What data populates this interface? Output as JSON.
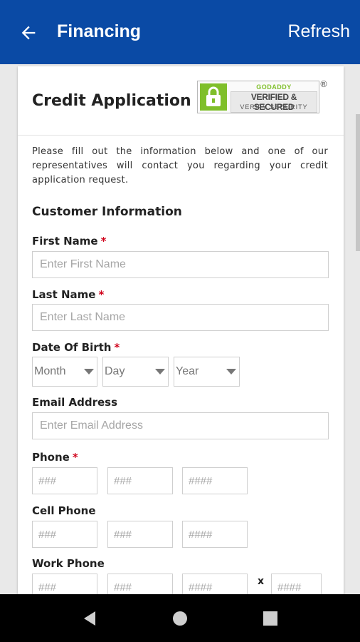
{
  "appbar": {
    "title": "Financing",
    "refresh_label": "Refresh",
    "back_icon": "arrow-left-icon",
    "color": "#0a4aa5"
  },
  "card": {
    "title": "Credit Application",
    "badge": {
      "brand": "GODADDY",
      "verified": "VERIFIED & SECURED",
      "verify": "VERIFY SECURITY",
      "reg_mark": "®"
    },
    "intro": "Please fill out the information below and one of our representatives will contact you regarding your credit application request."
  },
  "customer": {
    "section_title": "Customer Information",
    "required_mark": "*",
    "first_name": {
      "label": "First Name",
      "placeholder": "Enter First Name",
      "value": ""
    },
    "last_name": {
      "label": "Last Name",
      "placeholder": "Enter Last Name",
      "value": ""
    },
    "dob": {
      "label": "Date Of Birth",
      "month": "Month",
      "day": "Day",
      "year": "Year"
    },
    "email": {
      "label": "Email Address",
      "placeholder": "Enter Email Address",
      "value": ""
    },
    "phone": {
      "label": "Phone",
      "area": "###",
      "prefix": "###",
      "line": "####"
    },
    "cell_phone": {
      "label": "Cell Phone",
      "area": "###",
      "prefix": "###",
      "line": "####"
    },
    "work_phone": {
      "label": "Work Phone",
      "area": "###",
      "prefix": "###",
      "line": "####",
      "ext_label": "x",
      "ext": "####"
    }
  },
  "navbar": {
    "back_icon": "nav-back-triangle-icon",
    "home_icon": "nav-home-circle-icon",
    "recents_icon": "nav-recents-square-icon"
  }
}
